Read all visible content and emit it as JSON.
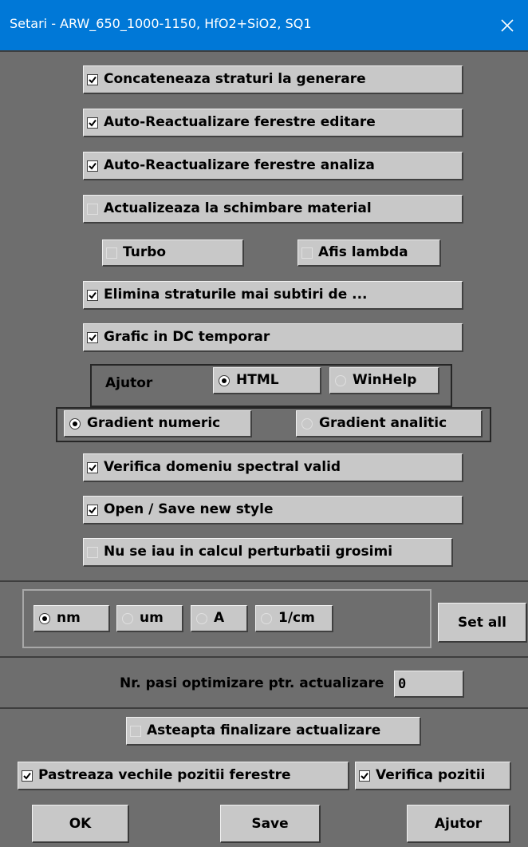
{
  "window": {
    "title": "Setari - ARW_650_1000-1150, HfO2+SiO2, SQ1"
  },
  "checkboxes": {
    "concat": {
      "label": "Concateneaza straturi la generare",
      "checked": true
    },
    "auto_edit": {
      "label": "Auto-Reactualizare ferestre editare",
      "checked": true
    },
    "auto_analiza": {
      "label": "Auto-Reactualizare ferestre analiza",
      "checked": true
    },
    "actualizeaza": {
      "label": "Actualizeaza la schimbare material",
      "checked": false
    },
    "turbo": {
      "label": "Turbo",
      "checked": false
    },
    "afis_lambda": {
      "label": "Afis lambda",
      "checked": false
    },
    "elimina": {
      "label": "Elimina straturile mai subtiri de ...",
      "checked": true
    },
    "grafic": {
      "label": "Grafic in DC temporar",
      "checked": true
    },
    "verifica_domeniu": {
      "label": "Verifica domeniu spectral valid",
      "checked": true
    },
    "open_save": {
      "label": "Open / Save new style",
      "checked": true
    },
    "perturbatii": {
      "label": "Nu se iau in calcul perturbatii grosimi",
      "checked": false
    },
    "asteapta": {
      "label": "Asteapta finalizare actualizare",
      "checked": false
    },
    "pastreaza": {
      "label": "Pastreaza vechile pozitii ferestre",
      "checked": true
    },
    "verifica_pozitii": {
      "label": "Verifica pozitii",
      "checked": true
    }
  },
  "ajutor": {
    "label": "Ajutor",
    "options": [
      {
        "label": "HTML",
        "selected": true
      },
      {
        "label": "WinHelp",
        "selected": false
      }
    ]
  },
  "gradient": {
    "options": [
      {
        "label": "Gradient numeric",
        "selected": true
      },
      {
        "label": "Gradient analitic",
        "selected": false
      }
    ]
  },
  "units": {
    "options": [
      {
        "label": "nm",
        "selected": true
      },
      {
        "label": "um",
        "selected": false
      },
      {
        "label": "A",
        "selected": false
      },
      {
        "label": "1/cm",
        "selected": false
      }
    ],
    "set_all_label": "Set all"
  },
  "steps": {
    "label": "Nr. pasi optimizare ptr. actualizare",
    "value": "0"
  },
  "buttons": {
    "ok": "OK",
    "save": "Save",
    "ajutor": "Ajutor"
  }
}
